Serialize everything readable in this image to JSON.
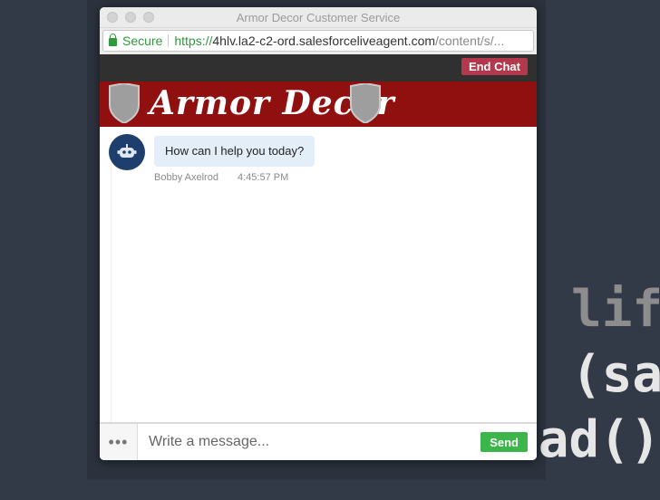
{
  "window": {
    "title": "Armor Decor Customer Service"
  },
  "address_bar": {
    "secure_label": "Secure",
    "url_scheme_host": "https://",
    "url_host": "4hlv.la2-c2-ord.salesforceliveagent.com",
    "url_path": "/content/s/..."
  },
  "toolbar": {
    "end_chat_label": "End Chat"
  },
  "banner": {
    "brand_name": "Armor Decor"
  },
  "chat": {
    "messages": [
      {
        "text": "How can I help you today?",
        "sender": "Bobby Axelrod",
        "time": "4:45:57 PM"
      }
    ]
  },
  "composer": {
    "more_icon": "ellipsis-icon",
    "placeholder": "Write a message...",
    "send_label": "Send"
  },
  "background": {
    "code_lines": [
      "lif",
      "(sa",
      "sad()"
    ]
  },
  "colors": {
    "end_chat": "#b3384b",
    "banner": "#900f0f",
    "send": "#3cb54a",
    "secure": "#2e9a3c",
    "bubble": "#e3eef9",
    "desktop": "#323a47"
  }
}
